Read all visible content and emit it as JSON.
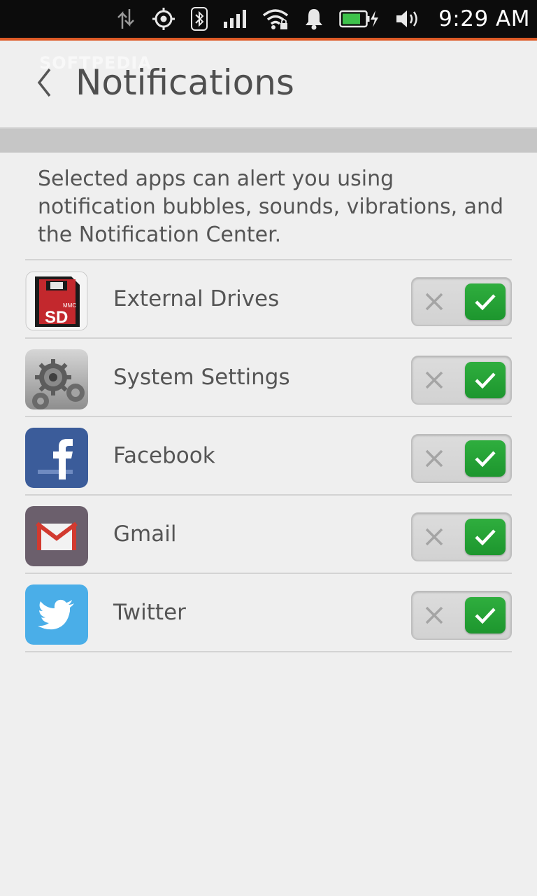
{
  "status_bar": {
    "time": "9:29 AM",
    "icons": [
      "data-transfer-icon",
      "location-icon",
      "bluetooth-icon",
      "cell-signal-icon",
      "wifi-icon",
      "notification-bell-icon",
      "battery-charging-icon",
      "volume-icon"
    ]
  },
  "header": {
    "watermark": "SOFTPEDIA",
    "title": "Notifications",
    "back_icon": "chevron-left-icon"
  },
  "description": "Selected apps can alert you using notification bubbles, sounds, vibrations, and the Notification Center.",
  "apps": [
    {
      "label": "External Drives",
      "icon": "sd-card-icon",
      "enabled": true
    },
    {
      "label": "System Settings",
      "icon": "gears-icon",
      "enabled": true
    },
    {
      "label": "Facebook",
      "icon": "facebook-icon",
      "enabled": true
    },
    {
      "label": "Gmail",
      "icon": "gmail-icon",
      "enabled": true
    },
    {
      "label": "Twitter",
      "icon": "twitter-icon",
      "enabled": true
    }
  ],
  "colors": {
    "accent": "#dd5a26",
    "toggle_on": "#1fa033",
    "background": "#efefef"
  }
}
